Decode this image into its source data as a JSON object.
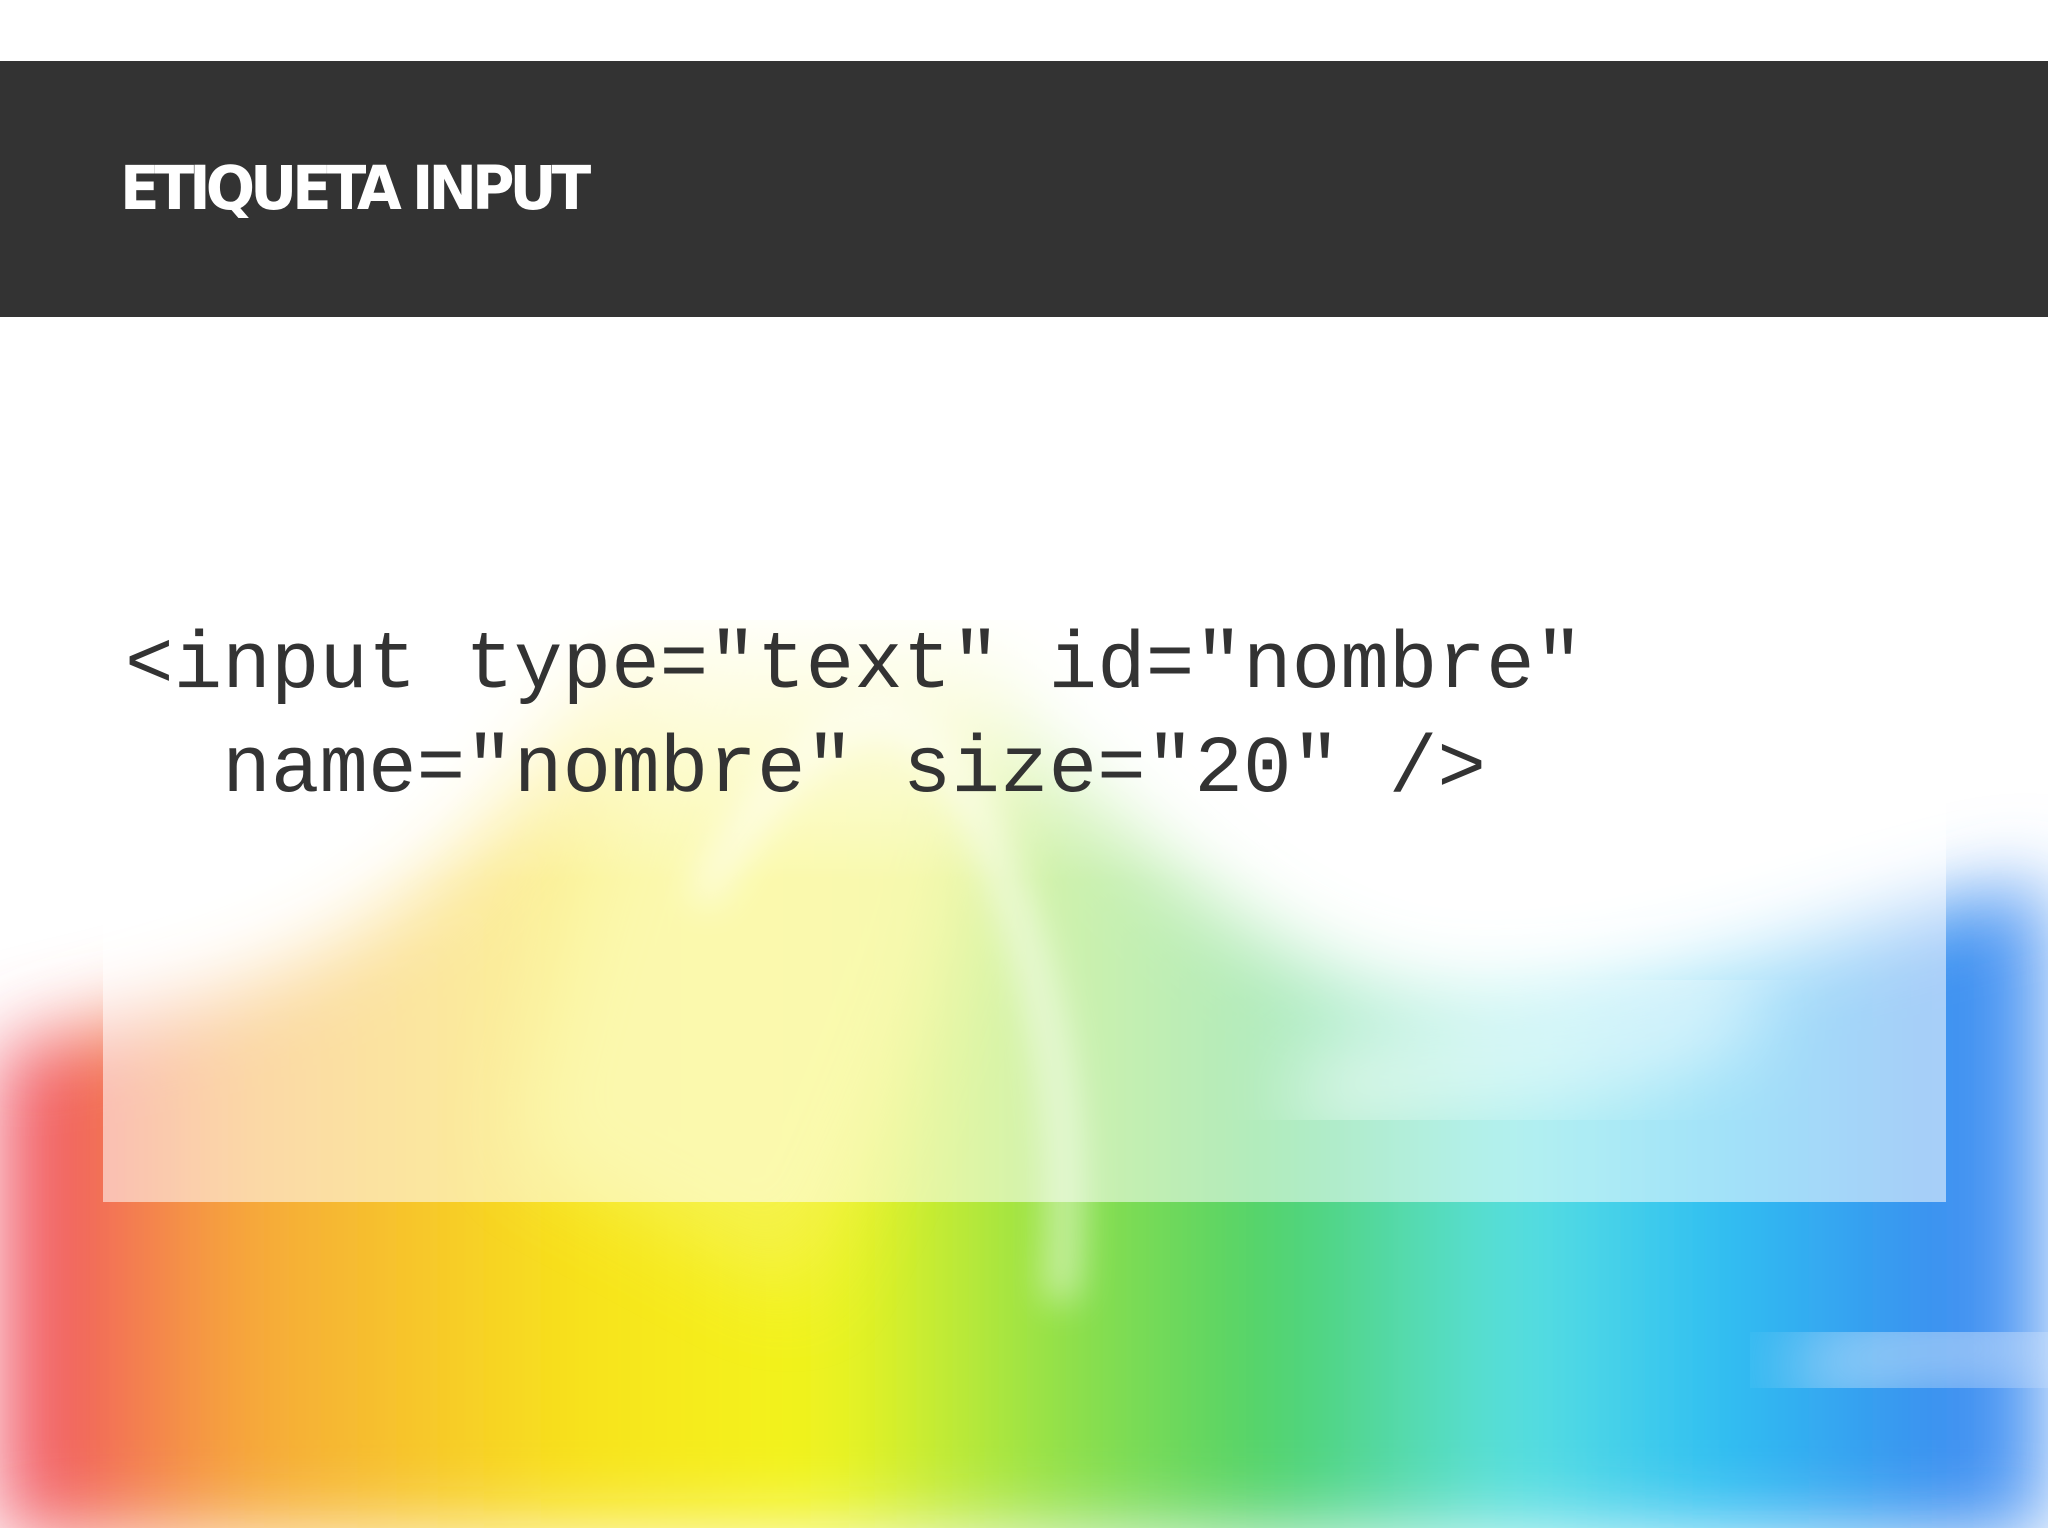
{
  "slide": {
    "title": "ETIQUETA INPUT",
    "code_line_1": "<input type=\"text\" id=\"nombre\"",
    "code_line_2": "  name=\"nombre\" size=\"20\" />"
  },
  "colors": {
    "header_bar": "#333333",
    "title_text": "#ffffff",
    "code_text": "#333333"
  }
}
